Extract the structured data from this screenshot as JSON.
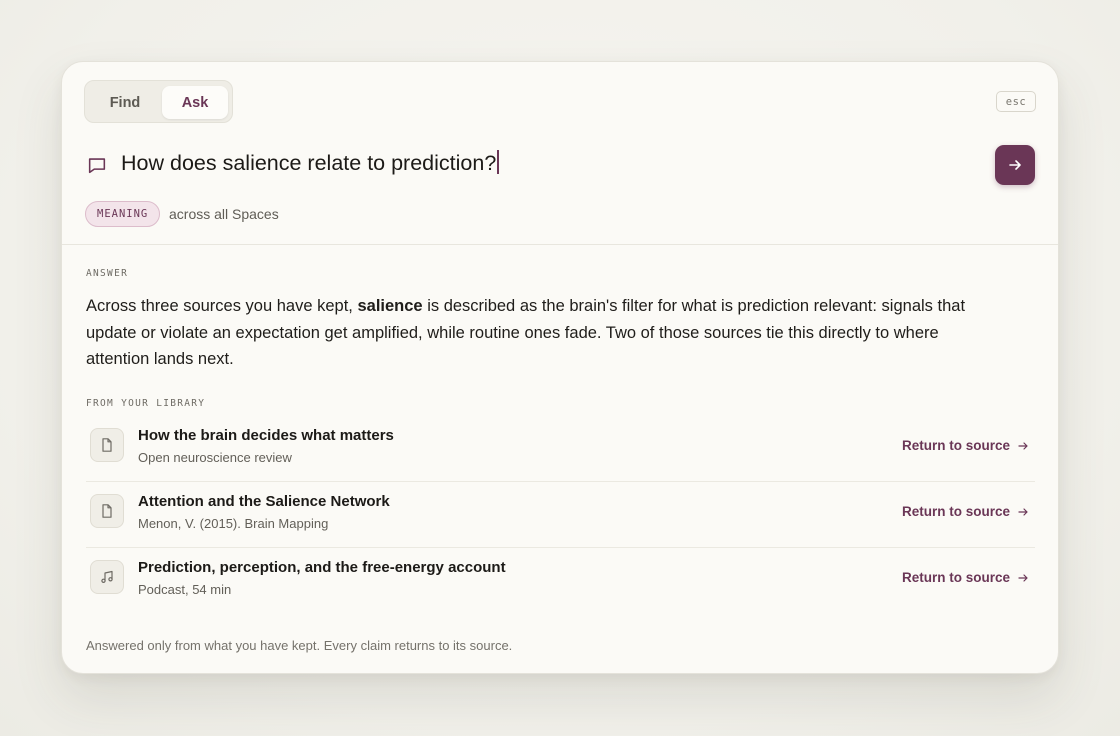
{
  "tabs": {
    "find": "Find",
    "ask": "Ask"
  },
  "esc_key": "esc",
  "query": {
    "value": "How does salience relate to prediction?"
  },
  "mode_badge": "MEANING",
  "scope": "across all Spaces",
  "answer": {
    "label": "ANSWER",
    "before": "Across three sources you have kept, ",
    "term": "salience",
    "after": " is described as the brain's filter for what is prediction relevant: signals that update or violate an expectation get amplified, while routine ones fade. Two of those sources tie this directly to where attention lands next."
  },
  "library": {
    "label": "FROM YOUR LIBRARY",
    "items": [
      {
        "title": "How the brain decides what matters",
        "meta": "Open neuroscience review",
        "icon": "document-icon",
        "link": "Return to source"
      },
      {
        "title": "Attention and the Salience Network",
        "meta": "Menon, V. (2015). Brain Mapping",
        "icon": "document-icon",
        "link": "Return to source"
      },
      {
        "title": "Prediction, perception, and the free-energy account",
        "meta": "Podcast, 54 min",
        "icon": "music-note-icon",
        "link": "Return to source"
      }
    ]
  },
  "footer": "Answered only from what you have kept. Every claim returns to its source.",
  "colors": {
    "accent": "#6a3656",
    "badge_bg": "#f3e4ea",
    "panel_bg": "#fbfaf6"
  }
}
